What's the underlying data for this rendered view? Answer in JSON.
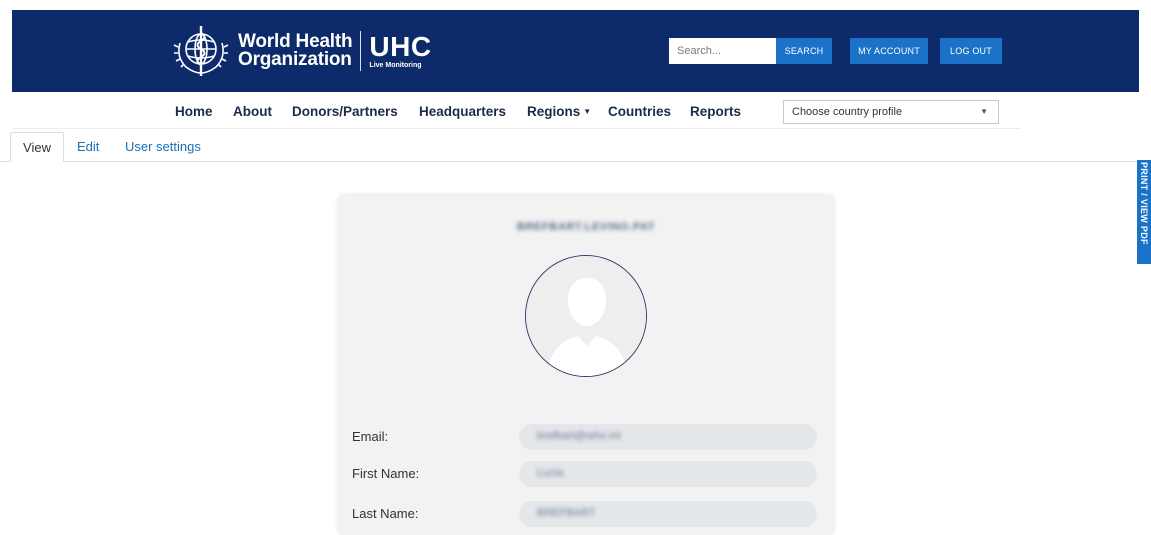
{
  "header": {
    "logo_line1": "World Health",
    "logo_line2": "Organization",
    "uhc_title": "UHC",
    "uhc_subtitle": "Live Monitoring",
    "search_placeholder": "Search...",
    "search_button": "SEARCH",
    "account_button": "MY ACCOUNT",
    "logout_button": "LOG OUT",
    "bg_color": "#0d2b6b",
    "button_color": "#1a73c9"
  },
  "nav": {
    "items": [
      "Home",
      "About",
      "Donors/Partners",
      "Headquarters",
      "Regions",
      "Countries",
      "Reports"
    ],
    "country_select": "Choose country profile"
  },
  "tabs": {
    "view": "View",
    "edit": "Edit",
    "settings": "User settings",
    "active": "View"
  },
  "side_tab": {
    "label": "PRINT / VIEW PDF"
  },
  "profile": {
    "username": "BREFBART.LEVINO.PAT",
    "avatar_icon": "user-silhouette-icon",
    "fields": [
      {
        "label": "Email:",
        "value": "brefbart@who.int"
      },
      {
        "label": "First Name:",
        "value": "Lucia"
      },
      {
        "label": "Last Name:",
        "value": "BREFBART"
      }
    ]
  }
}
